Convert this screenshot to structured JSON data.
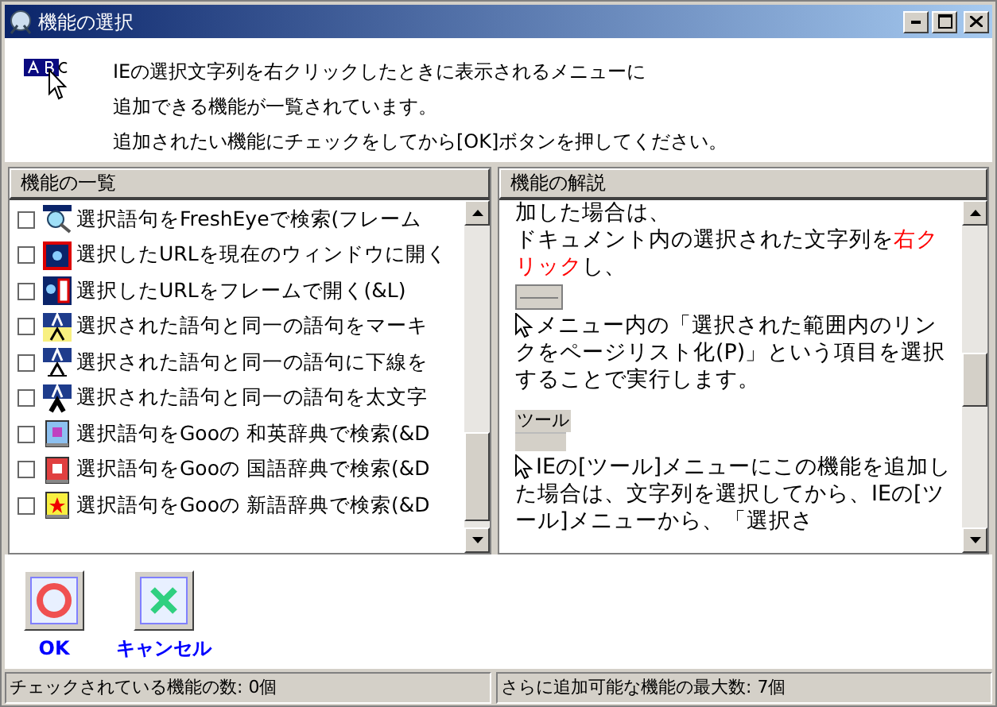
{
  "window": {
    "title": "機能の選択"
  },
  "intro": {
    "lines": [
      "IEの選択文字列を右クリックしたときに表示されるメニューに",
      "追加できる機能が一覧されています。",
      "追加されたい機能にチェックをしてから[OK]ボタンを押してください。"
    ]
  },
  "feature_list": {
    "title": "機能の一覧",
    "items": [
      {
        "label": "選択語句をFreshEyeで検索(フレーム",
        "checked": false,
        "kind": "search"
      },
      {
        "label": "選択したURLを現在のウィンドウに開く",
        "checked": false,
        "kind": "window"
      },
      {
        "label": "選択したURLをフレームで開く(&L)",
        "checked": false,
        "kind": "frame"
      },
      {
        "label": "選択された語句と同一の語句をマーキ",
        "checked": false,
        "kind": "marker"
      },
      {
        "label": "選択された語句と同一の語句に下線を",
        "checked": false,
        "kind": "underline"
      },
      {
        "label": "選択された語句と同一の語句を太文字",
        "checked": false,
        "kind": "bold"
      },
      {
        "label": "選択語句をGooの 和英辞典で検索(&D",
        "checked": false,
        "kind": "dict-je"
      },
      {
        "label": "選択語句をGooの 国語辞典で検索(&D",
        "checked": false,
        "kind": "dict-j"
      },
      {
        "label": "選択語句をGooの 新語辞典で検索(&D",
        "checked": false,
        "kind": "dict-new"
      }
    ]
  },
  "description": {
    "title": "機能の解説",
    "blocks": [
      {
        "kind": "text",
        "segments": [
          {
            "text": "加した場合は、",
            "highlight": false
          }
        ]
      },
      {
        "kind": "text",
        "segments": [
          {
            "text": "ドキュメント内の選択された文字列を",
            "highlight": false
          },
          {
            "text": "右クリック",
            "highlight": true
          },
          {
            "text": "し、",
            "highlight": false
          }
        ]
      },
      {
        "kind": "menu-image"
      },
      {
        "kind": "cursor-text",
        "segments": [
          {
            "text": "メニュー内の「選択された範囲内のリンクをページリスト化(P)」という項目を選択することで実行します。",
            "highlight": false
          }
        ]
      },
      {
        "kind": "toolbar-image",
        "label": "ツール"
      },
      {
        "kind": "cursor-text",
        "segments": [
          {
            "text": "IEの[ツール]メニューにこの機能を追加した場合は、文字列を選択してから、IEの[ツール]メニューから、「選択さ",
            "highlight": false
          }
        ]
      }
    ]
  },
  "buttons": [
    {
      "label": "OK",
      "kind": "ok"
    },
    {
      "label": "キャンセル",
      "kind": "cancel"
    }
  ],
  "status_bar": [
    "チェックされている機能の数: 0個",
    "さらに追加可能な機能の最大数: 7個"
  ]
}
